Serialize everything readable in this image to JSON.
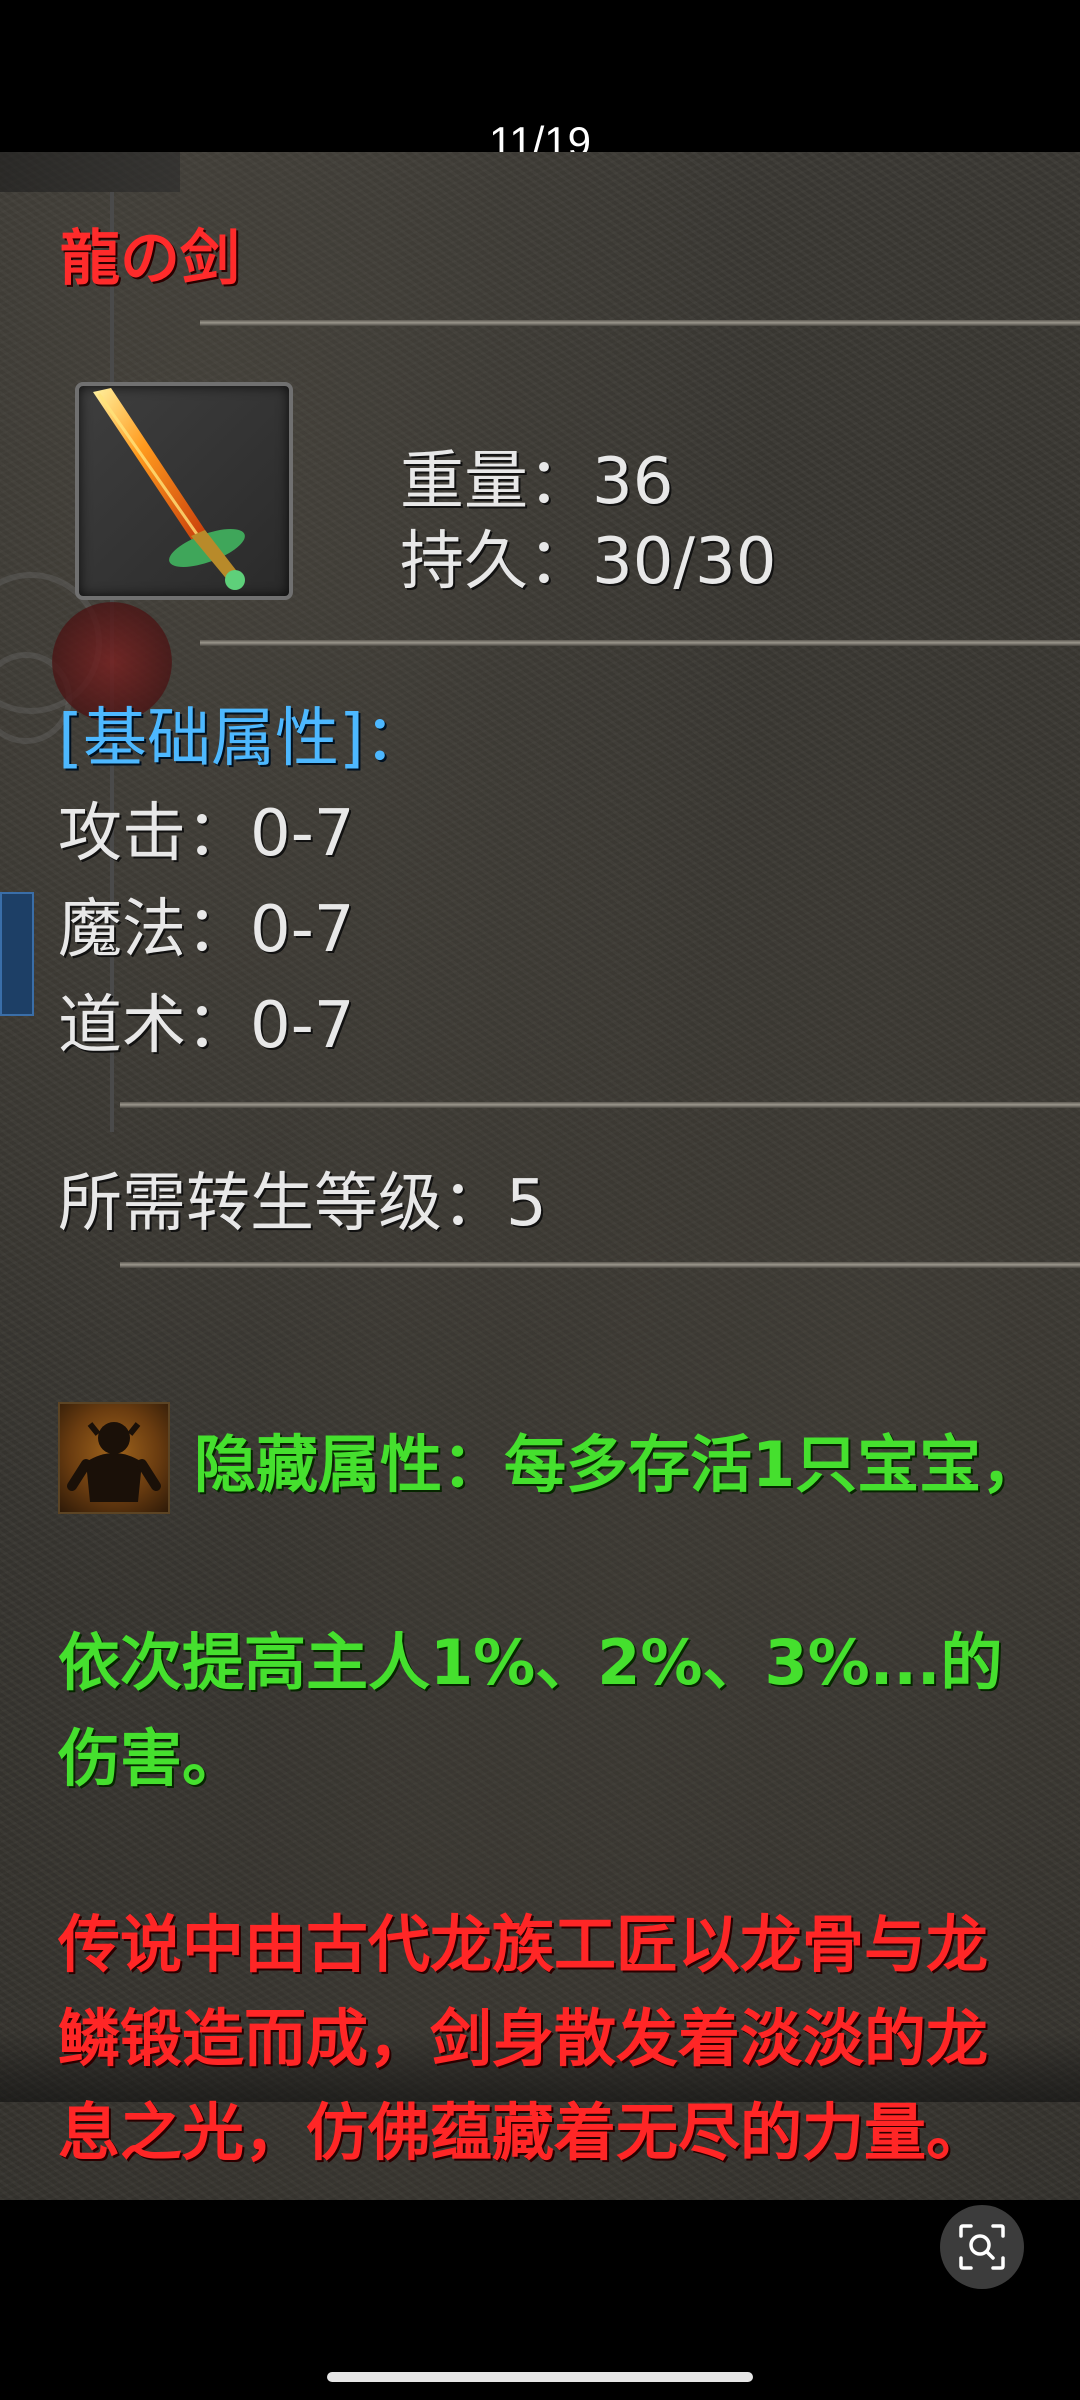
{
  "viewer": {
    "page_counter": "11/19"
  },
  "item": {
    "name": "龍の剑",
    "weight_line": "重量：36",
    "durability_line": "持久：30/30"
  },
  "base_attributes": {
    "header": "[基础属性]：",
    "attack": "攻击：0-7",
    "magic": "魔法：0-7",
    "taoism": "道术：0-7"
  },
  "requirement": {
    "rebirth_level": "所需转生等级：5"
  },
  "hidden_attribute": {
    "line1": "隐藏属性：每多存活1只宝宝，",
    "line2": "依次提高主人1%、2%、3%...的",
    "line3": "伤害。"
  },
  "lore": {
    "line1": "传说中由古代龙族工匠以龙骨与龙",
    "line2": "鳞锻造而成，剑身散发着淡淡的龙",
    "line3": "息之光，仿佛蕴藏着无尽的力量。"
  },
  "colors": {
    "title_red": "#ff2b2b",
    "section_blue": "#4db8ff",
    "hidden_green": "#45e02e",
    "lore_red": "#ff2626",
    "stat_white": "#e8e8e8"
  },
  "icons": {
    "item_icon": "dragon-sword-icon",
    "hidden_attr_icon": "pet-monster-icon",
    "scan_button": "scan-search-icon"
  }
}
